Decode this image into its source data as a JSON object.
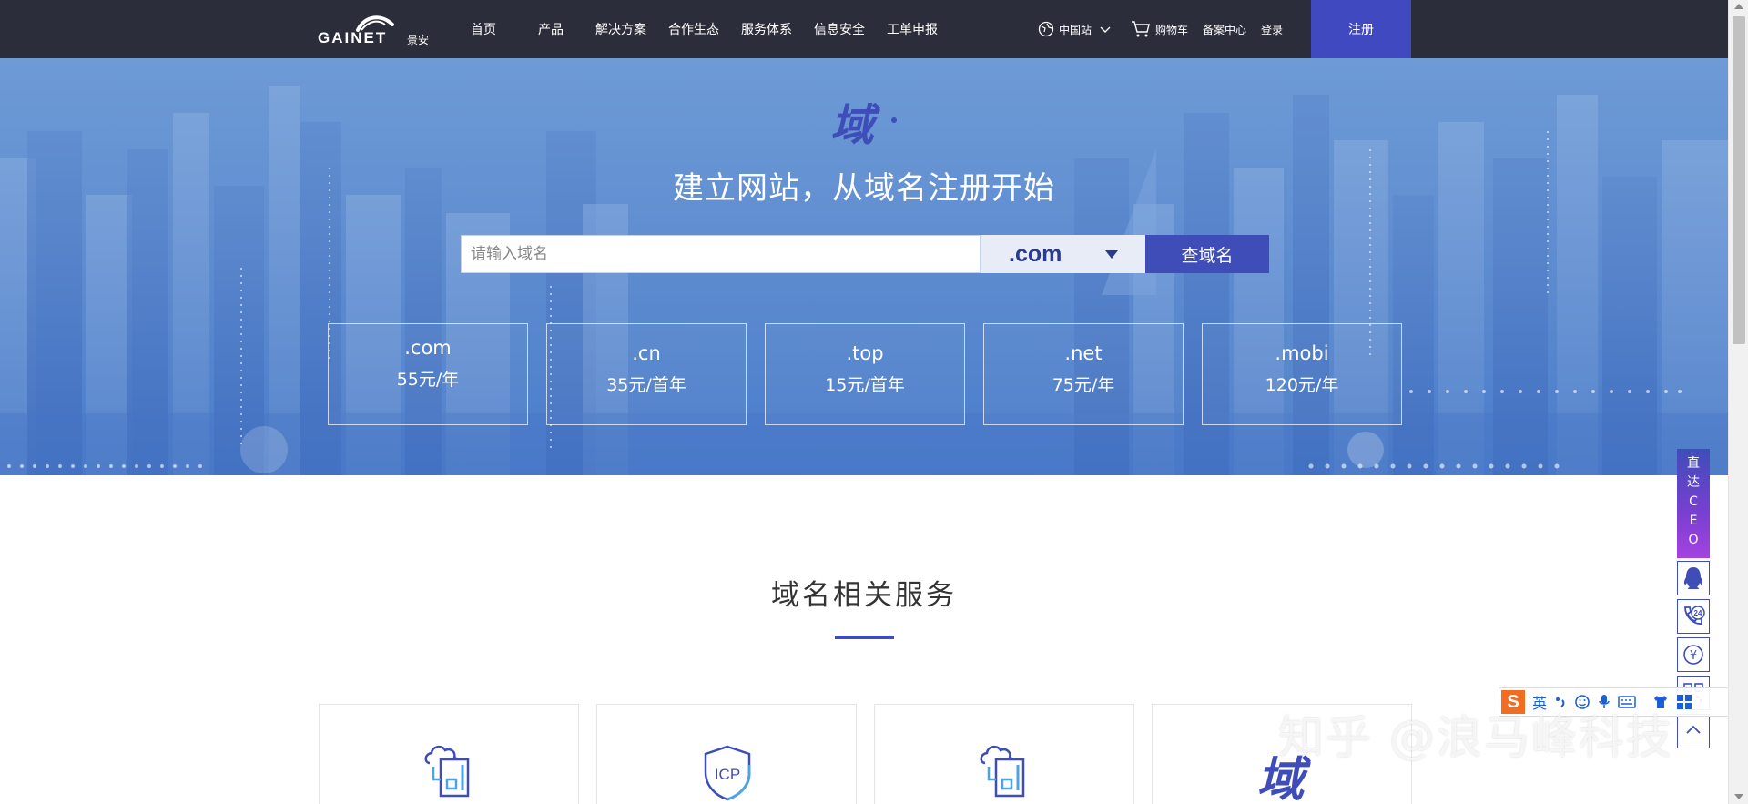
{
  "brand": {
    "logo_text": "GAINET",
    "logo_cn": "景安"
  },
  "nav": {
    "items": [
      "首页",
      "产品",
      "解决方案",
      "合作生态",
      "服务体系",
      "信息安全",
      "工单申报"
    ],
    "region": "中国站",
    "cart": "购物车",
    "filing": "备案中心",
    "login": "登录",
    "register": "注册"
  },
  "hero": {
    "logo_glyph": "域",
    "title": "建立网站，从域名注册开始",
    "search_placeholder": "请输入域名",
    "tld_selected": ".com",
    "search_button": "查域名",
    "tld_prices": [
      {
        "name": ".com",
        "price": "55元/年"
      },
      {
        "name": ".cn",
        "price": "35元/首年"
      },
      {
        "name": ".top",
        "price": "15元/首年"
      },
      {
        "name": ".net",
        "price": "75元/年"
      },
      {
        "name": ".mobi",
        "price": "120元/年"
      }
    ]
  },
  "services": {
    "title": "域名相关服务",
    "icons": [
      "cloud-document-icon",
      "icp-shield-icon",
      "cloud-document-icon",
      "domain-glyph-icon"
    ],
    "icp_label": "ICP",
    "domain_glyph": "域"
  },
  "sidebar": {
    "ceo_chars": [
      "直",
      "达",
      "C",
      "E",
      "O"
    ],
    "phone_badge": "24",
    "yuan_symbol": "¥"
  },
  "ime": {
    "lang": "英"
  },
  "watermark": "知乎 @浪马峰科技",
  "colors": {
    "nav_bg": "#2c2d3a",
    "accent": "#3f4db9",
    "hero_blue": "#5f8dd0"
  }
}
